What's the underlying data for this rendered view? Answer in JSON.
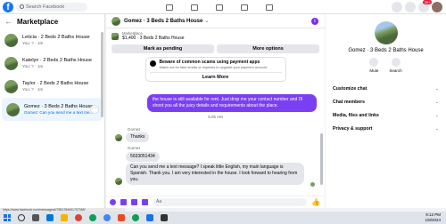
{
  "topbar": {
    "logo": "f",
    "search_placeholder": "Search Facebook",
    "notification_count": "20+"
  },
  "sidebar": {
    "title": "Marketplace",
    "conversations": [
      {
        "name": "Leticia · 2 Beds 2 Baths House",
        "sub": "You: ? · 1m"
      },
      {
        "name": "Katelyn · 2 Beds 2 Baths House",
        "sub": "You: ? · 1m"
      },
      {
        "name": "Taylor · 2 Beds 2 Baths House",
        "sub": "You: ? · 1m"
      },
      {
        "name": "Gomez · 3 Beds 2 Baths House",
        "sub": "Gomez: Can you send me a text me..."
      }
    ],
    "more_glyph": "···"
  },
  "chat": {
    "title": "Gomez · 3 Beds 2 Baths House",
    "listing_label": "Marketplace",
    "listing_title": "$1,400 · 3 Beds 2 Baths House",
    "mark_pending": "Mark as pending",
    "more_options": "More options",
    "scam_title": "Beware of common scams using payment apps",
    "scam_desc": "Watch out for fake emails or requests to upgrade your payment account.",
    "learn_more": "Learn More",
    "outgoing_message": "the house is still available for rent. Just drop me your contact number and I'll shoot you all the juicy details and requirements about the place.",
    "timestamp": "5:05 AM",
    "sender": "Gomez",
    "incoming": [
      {
        "text": "Thanks"
      },
      {
        "text": "5033051434"
      },
      {
        "text": "Can you send me a text message? I speak little English, my main language is Spanish. Thank you. I am very interested in the house. I look forward to hearing from you."
      }
    ],
    "composer_placeholder": "Aa"
  },
  "panel": {
    "name": "Gomez · 3 Beds 2 Baths House",
    "mute": "Mute",
    "search": "Search",
    "rows": [
      "Customize chat",
      "Chat members",
      "Media, files and links",
      "Privacy & support"
    ]
  },
  "status_url": "https://www.facebook.com/messages/t/7851784691757385/",
  "tray": {
    "time": "9:12 PM",
    "date": "1/8/2024"
  },
  "colors": {
    "accent": "#7b3ff2",
    "facebook_blue": "#1877f2"
  }
}
